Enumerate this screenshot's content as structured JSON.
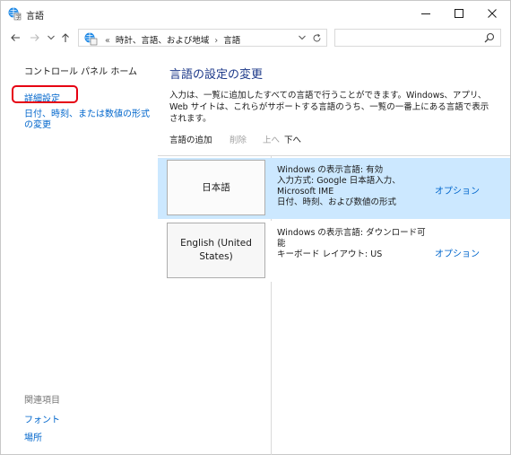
{
  "window": {
    "title": "言語",
    "app_icon": "language-icon",
    "controls": {
      "minimize": "—",
      "maximize": "☐",
      "close": "✕"
    }
  },
  "address_bar": {
    "prefix": "«",
    "crumbs": [
      "時計、言語、および地域",
      "言語"
    ],
    "separator": "›",
    "search_placeholder": ""
  },
  "left_pane": {
    "home_link": "コントロール パネル ホーム",
    "advanced_link": "詳細設定",
    "date_link": "日付、時刻、または数値の形式の変更",
    "related_heading": "関連項目",
    "related_links": [
      "フォント",
      "場所"
    ],
    "highlight_color": "#e60012"
  },
  "main": {
    "title": "言語の設定の変更",
    "description": "入力は、一覧に追加したすべての言語で行うことができます。Windows、アプリ、Web サイトは、これらがサポートする言語のうち、一覧の一番上にある言語で表示されます。",
    "toolbar": {
      "add": "言語の追加",
      "remove": "削除",
      "up": "上へ",
      "down": "下へ"
    },
    "languages": [
      {
        "name": "日本語",
        "info": [
          "Windows の表示言語: 有効",
          "入力方式: Google 日本語入力、Microsoft IME",
          "日付、時刻、および数値の形式"
        ],
        "option": "オプション",
        "selected": true
      },
      {
        "name": "English (United States)",
        "info": [
          "Windows の表示言語: ダウンロード可能",
          "キーボード レイアウト: US"
        ],
        "option": "オプション",
        "selected": false
      }
    ]
  },
  "colors": {
    "link": "#0066cc",
    "title": "#1e3a8a",
    "selected_row": "#cce8ff"
  }
}
